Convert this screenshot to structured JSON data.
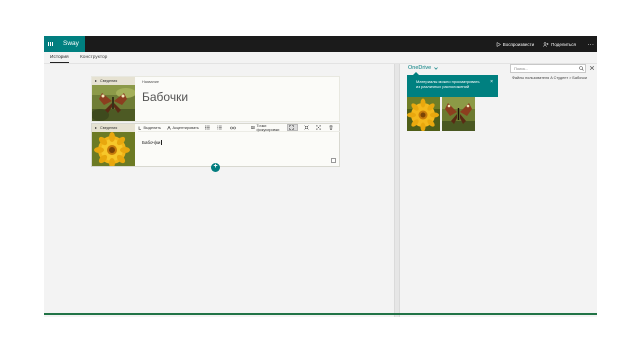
{
  "app": {
    "name": "Sway"
  },
  "topbar": {
    "actions": [
      {
        "label": "Воспроизвести",
        "icon": "play-icon"
      },
      {
        "label": "Поделиться",
        "icon": "share-icon"
      }
    ],
    "more_label": "..."
  },
  "tabs": [
    {
      "label": "История",
      "active": true
    },
    {
      "label": "Конструктор",
      "active": false
    }
  ],
  "storyline": {
    "cards": [
      {
        "type": "title",
        "thumb_label": "Сведения",
        "field_label": "Название",
        "title": "Бабочки"
      },
      {
        "type": "text",
        "thumb_label": "Сведения",
        "text": "Бабоч|ки"
      }
    ],
    "toolbar": [
      {
        "label": "Выделить",
        "icon": "highlight-icon"
      },
      {
        "label": "Акцентировать",
        "icon": "accent-icon"
      },
      {
        "label": "",
        "icon": "bullet-list-icon"
      },
      {
        "label": "",
        "icon": "numbered-list-icon"
      },
      {
        "label": "",
        "icon": "link-icon"
      },
      {
        "label": "Точки фокусировки",
        "icon": "focus-points-icon"
      }
    ],
    "add_label": "+"
  },
  "right_pane": {
    "source": "OneDrive",
    "search_placeholder": "Поиск...",
    "breadcrumb": "Файлы пользователя A Студент > Бабочки",
    "tooltip": "Материалы можно просматривать из различных расположений",
    "tooltip_close": "×",
    "images": [
      {
        "alt": "flower"
      },
      {
        "alt": "butterfly"
      }
    ]
  },
  "colors": {
    "accent": "#008080",
    "topbar": "#1b1b1b",
    "bottom_line": "#217346"
  }
}
